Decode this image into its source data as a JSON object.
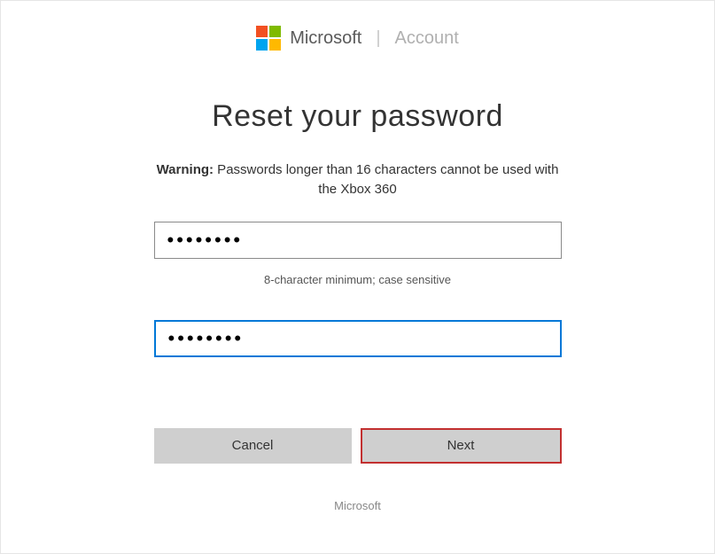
{
  "header": {
    "brand": "Microsoft",
    "section": "Account"
  },
  "page": {
    "title": "Reset your password",
    "warning_label": "Warning:",
    "warning_text": " Passwords longer than 16 characters cannot be used with the Xbox 360",
    "hint": "8-character minimum; case sensitive"
  },
  "form": {
    "password1_value": "••••••••",
    "password2_value": "••••••••"
  },
  "buttons": {
    "cancel": "Cancel",
    "next": "Next"
  },
  "footer": {
    "text": "Microsoft"
  }
}
